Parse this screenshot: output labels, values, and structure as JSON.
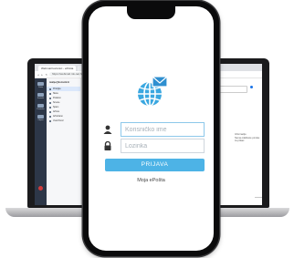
{
  "phone": {
    "login_form": {
      "username_placeholder": "Korisničko ime",
      "password_placeholder": "Lozinka",
      "submit_label": "PRIJAVA",
      "link_label": "Moja ePošta"
    },
    "accent_color": "#4db3e6",
    "logo_icon": "globe-envelope-icon"
  },
  "laptop": {
    "browser_tabs": [
      {
        "label": "Webmail korisnici - ePošta"
      },
      {
        "label": ""
      }
    ],
    "url": "https://webmail.mk-net.hr",
    "folder_panel_title": "mailpe@korisnik.hr",
    "folders": [
      {
        "label": "Pristigla"
      },
      {
        "label": "Skice"
      },
      {
        "label": "Poslano"
      },
      {
        "label": "Smeće"
      },
      {
        "label": "Spam"
      },
      {
        "label": "Arhiva"
      },
      {
        "label": "Arhivirano"
      },
      {
        "label": "Uvoz/Izvoz"
      }
    ],
    "sidebar_items": [
      "Pošta",
      "Kontakti",
      "Postavke",
      "Odjava"
    ],
    "info_text": [
      "Informacije",
      "Nema odabrane poruke za prikaz."
    ]
  }
}
